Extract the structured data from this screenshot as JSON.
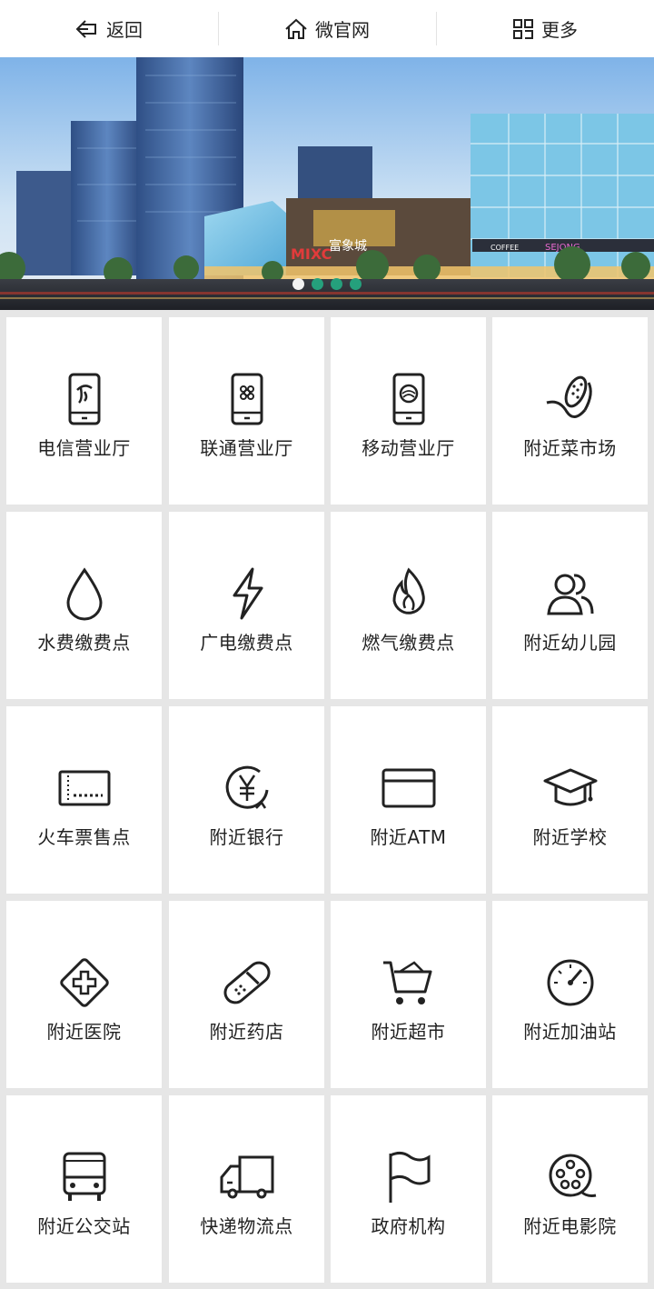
{
  "topbar": {
    "back_label": "返回",
    "home_label": "微官网",
    "more_label": "更多"
  },
  "banner": {
    "signs": [
      "MIXC",
      "富象城",
      "SEJONG",
      "COFFEE"
    ],
    "slide_count": 4,
    "active_slide": 1
  },
  "grid": {
    "items": [
      {
        "label": "电信营业厅",
        "icon": "phone-telecom-icon"
      },
      {
        "label": "联通营业厅",
        "icon": "phone-unicom-icon"
      },
      {
        "label": "移动营业厅",
        "icon": "phone-mobile-icon"
      },
      {
        "label": "附近菜市场",
        "icon": "corn-icon"
      },
      {
        "label": "水费缴费点",
        "icon": "water-drop-icon"
      },
      {
        "label": "广电缴费点",
        "icon": "lightning-icon"
      },
      {
        "label": "燃气缴费点",
        "icon": "flame-icon"
      },
      {
        "label": "附近幼儿园",
        "icon": "people-icon"
      },
      {
        "label": "火车票售点",
        "icon": "ticket-icon"
      },
      {
        "label": "附近银行",
        "icon": "yuan-coin-icon"
      },
      {
        "label": "附近ATM",
        "icon": "card-icon"
      },
      {
        "label": "附近学校",
        "icon": "graduation-cap-icon"
      },
      {
        "label": "附近医院",
        "icon": "medical-cross-icon"
      },
      {
        "label": "附近药店",
        "icon": "pill-icon"
      },
      {
        "label": "附近超市",
        "icon": "shopping-cart-icon"
      },
      {
        "label": "附近加油站",
        "icon": "gauge-icon"
      },
      {
        "label": "附近公交站",
        "icon": "bus-icon"
      },
      {
        "label": "快递物流点",
        "icon": "truck-icon"
      },
      {
        "label": "政府机构",
        "icon": "flag-icon"
      },
      {
        "label": "附近电影院",
        "icon": "film-reel-icon"
      }
    ]
  }
}
